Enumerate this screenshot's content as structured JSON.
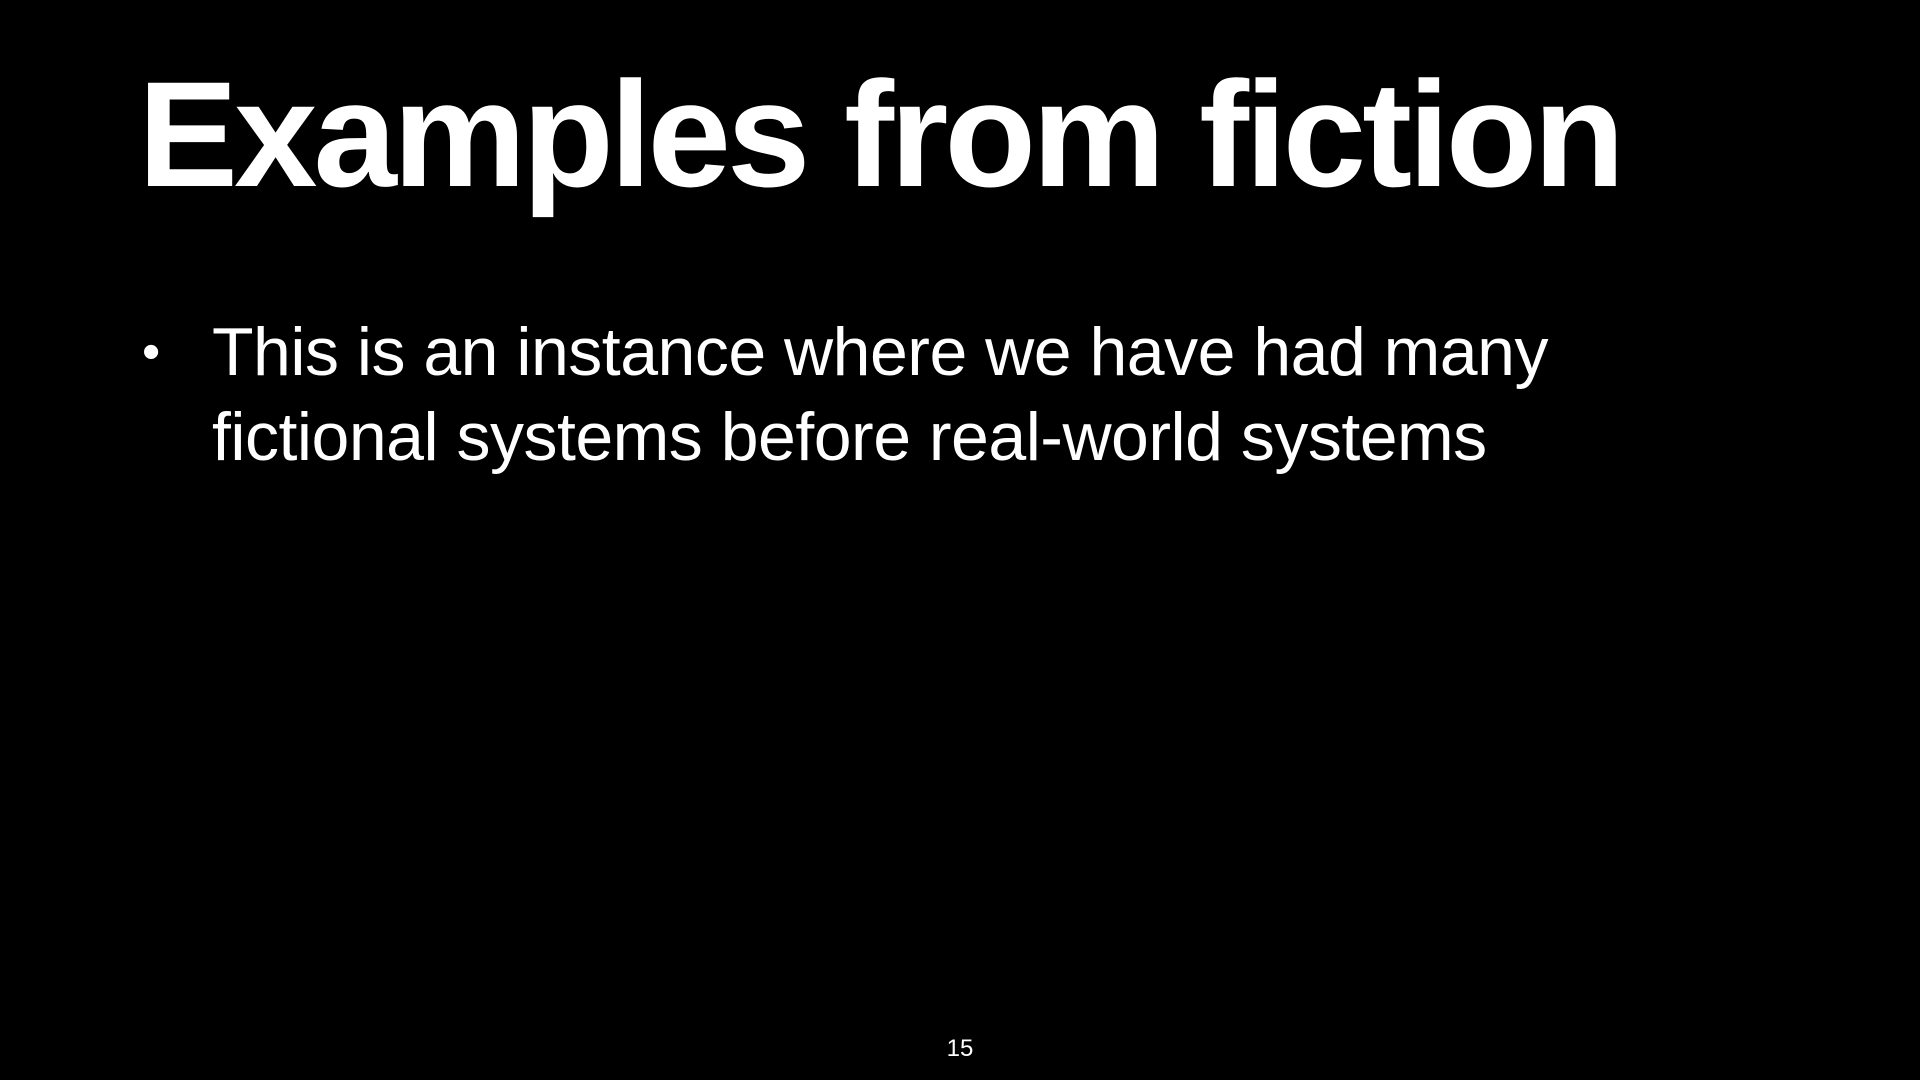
{
  "slide": {
    "title": "Examples from fiction",
    "bullets": [
      {
        "lines": [
          "This is an instance where we have had many",
          "fictional systems before real-world systems"
        ]
      }
    ],
    "page_number": "15",
    "colors": {
      "background": "#000000",
      "text": "#ffffff"
    }
  }
}
